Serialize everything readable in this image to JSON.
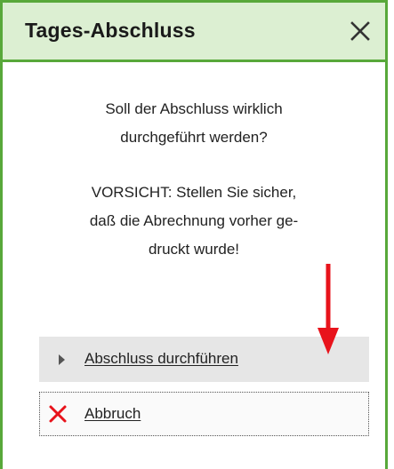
{
  "dialog": {
    "title": "Tages-Abschluss",
    "close_icon": "close-icon",
    "message": {
      "line1": "Soll der Abschluss wirklich",
      "line2": "durchgeführt werden?",
      "line3": "VORSICHT: Stellen Sie sicher,",
      "line4": "daß die Abrechnung vorher ge-",
      "line5": "druckt wurde!"
    },
    "execute_button": {
      "label": "Abschluss durchführen",
      "icon": "triangle-right-icon"
    },
    "cancel_button": {
      "label": "Abbruch",
      "icon": "red-x-icon"
    },
    "annotation": {
      "icon": "red-arrow-down-icon",
      "color": "#e8131b"
    },
    "colors": {
      "frame": "#58a83a",
      "titlebar_bg": "#dcefd2",
      "execute_bg": "#e6e6e6",
      "cancel_x": "#e8131b"
    }
  }
}
